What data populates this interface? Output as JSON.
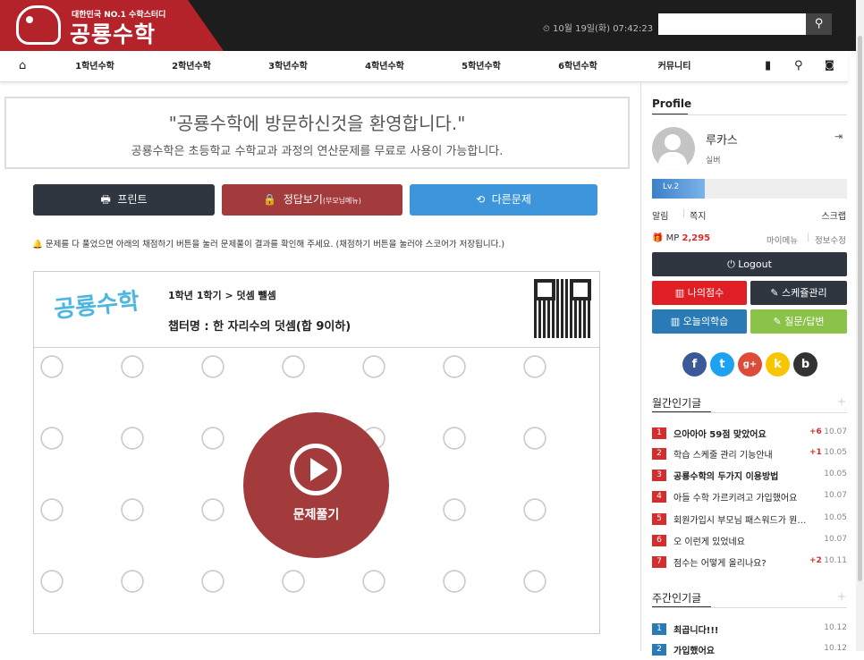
{
  "header": {
    "logo_sub": "대한민국 NO.1 수학스터디",
    "logo_main": "공룡수학",
    "datetime": "⏲ 10월 19일(화) 07:42:23",
    "search_icon": "search-icon"
  },
  "nav": {
    "home_icon": "home-icon",
    "items": [
      "1학년수학",
      "2학년수학",
      "3학년수학",
      "4학년수학",
      "5학년수학",
      "6학년수학",
      "커뮤니티"
    ]
  },
  "welcome": {
    "title": "\"공룡수학에 방문하신것을 환영합니다.\"",
    "subtitle": "공룡수학은 초등학교 수학교과 과정의 연산문제를 무료로 사용이 가능합니다."
  },
  "actions": {
    "print": "프린트",
    "answer": "정답보기",
    "answer_note": "(부모님메뉴)",
    "other": "다른문제"
  },
  "notice": "🔔 문제를 다 풀었으면 아래의 채점하기 버튼을 눌러 문제풀이 결과를 확인해 주세요. (채점하기 버튼을 눌러야 스코어가 저장됩니다.)",
  "worksheet": {
    "logo": "공룡수학",
    "path": "1학년 1학기 > 덧셈 뺄셈",
    "chapter": "챕터명 : 한 자리수의 덧셈(합 9이하)",
    "play_label": "문제풀기"
  },
  "profile": {
    "heading": "Profile",
    "name": "루카스",
    "grade": "실버",
    "level": "Lv.2",
    "level_progress": 0.27,
    "links": [
      "알림",
      "쪽지",
      "스크랩"
    ],
    "mp_label": "MP",
    "mp_value": "2,295",
    "mypage": "마이메뉴",
    "info_edit": "정보수정",
    "logout": "Logout",
    "my_score": "나의점수",
    "schedule": "스케쥴관리",
    "today_study": "오늘의학습",
    "qna": "질문/답변"
  },
  "social": [
    {
      "label": "f",
      "color": "#3b5998"
    },
    {
      "label": "t",
      "color": "#1da1f2"
    },
    {
      "label": "g+",
      "color": "#dd4b39"
    },
    {
      "label": "k",
      "color": "#f7c600"
    },
    {
      "label": "b",
      "color": "#333333"
    }
  ],
  "monthly": {
    "heading": "월간인기글",
    "items": [
      {
        "num": "1",
        "title": "으아아아 59점 맞았어요",
        "plus": "+6",
        "date": "10.07"
      },
      {
        "num": "2",
        "title": "학습 스케줄 관리 기능안내",
        "plus": "+1",
        "date": "10.05"
      },
      {
        "num": "3",
        "title": "공룡수학의 두가지 이용방법",
        "plus": "",
        "date": "10.05"
      },
      {
        "num": "4",
        "title": "아들 수학 가르키려고 가입했어요",
        "plus": "",
        "date": "10.07"
      },
      {
        "num": "5",
        "title": "회원가입시 부모님 패스워드가 뭔가요",
        "plus": "",
        "date": "10.05"
      },
      {
        "num": "6",
        "title": "오 이런게 있었네요",
        "plus": "",
        "date": "10.07"
      },
      {
        "num": "7",
        "title": "점수는 어떻게 올리나요?",
        "plus": "+2",
        "date": "10.11"
      }
    ]
  },
  "weekly": {
    "heading": "주간인기글",
    "items": [
      {
        "num": "1",
        "title": "최곱니다!!!",
        "date": "10.12"
      },
      {
        "num": "2",
        "title": "가입했어요",
        "date": "10.12"
      }
    ]
  },
  "colors": {
    "brand_red": "#b4222a",
    "dark": "#2f3640",
    "answer_red": "#a33a3b",
    "blue": "#3d96db"
  }
}
